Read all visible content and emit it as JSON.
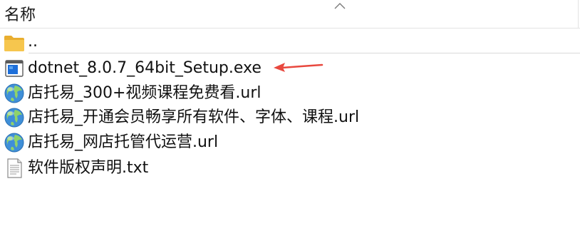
{
  "header": {
    "name_column": "名称"
  },
  "files": [
    {
      "name": "..",
      "icon": "folder-icon"
    },
    {
      "name": "dotnet_8.0.7_64bit_Setup.exe",
      "icon": "exe-icon"
    },
    {
      "name": "店托易_300+视频课程免费看.url",
      "icon": "globe-icon"
    },
    {
      "name": "店托易_开通会员畅享所有软件、字体、课程.url",
      "icon": "globe-icon"
    },
    {
      "name": "店托易_网店托管代运营.url",
      "icon": "globe-icon"
    },
    {
      "name": "软件版权声明.txt",
      "icon": "text-file-icon"
    }
  ],
  "colors": {
    "folder": "#f6c64e",
    "exe_icon": "#1e6fd9",
    "pointer_arrow": "#e8483e",
    "divider": "#e3e3e3"
  }
}
